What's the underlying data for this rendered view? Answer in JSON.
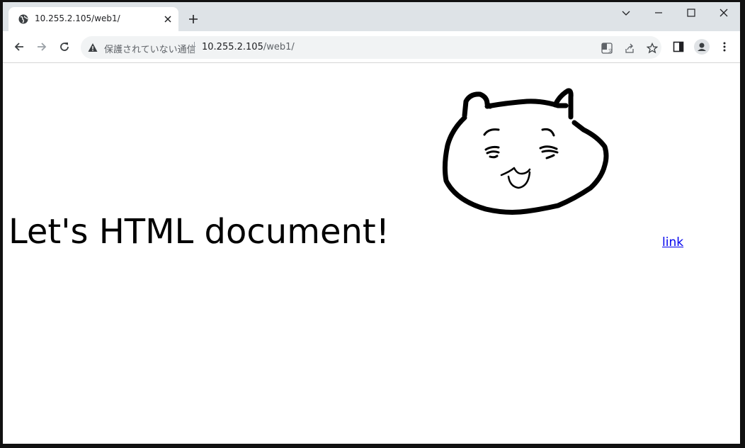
{
  "tab": {
    "title": "10.255.2.105/web1/",
    "favicon": "globe-icon",
    "close_icon": "close-icon"
  },
  "window_controls": [
    "chevron-down-icon",
    "minimize-icon",
    "maximize-icon",
    "close-icon"
  ],
  "toolbar": {
    "back_icon": "back-arrow-icon",
    "forward_icon": "forward-arrow-icon",
    "reload_icon": "reload-icon",
    "security_icon": "warning-icon",
    "security_text": "保護されていない通信",
    "url_host": "10.255.2.105",
    "url_path": "/web1/",
    "omnibox_icons": [
      "translate-icon",
      "share-icon",
      "star-icon"
    ],
    "side_icons": [
      "side-panel-icon",
      "profile-icon",
      "menu-icon"
    ]
  },
  "page": {
    "heading": "Let's HTML document!",
    "link_text": "link",
    "image": "cat-drawing"
  },
  "colors": {
    "tabstrip": "#dee3e7",
    "link": "#0000ee",
    "omnibox": "#f1f3f4"
  }
}
